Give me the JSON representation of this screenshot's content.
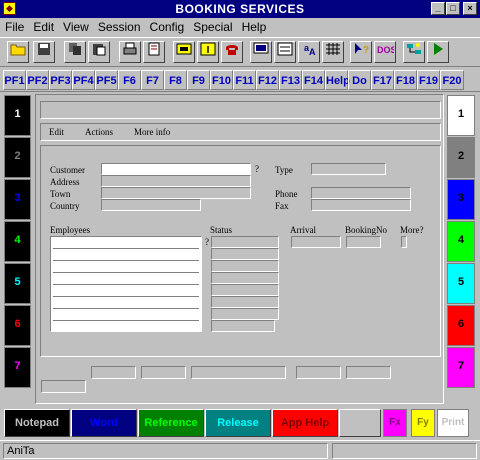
{
  "window": {
    "title": "BOOKING SERVICES",
    "icon": "app-icon"
  },
  "menu": [
    "File",
    "Edit",
    "View",
    "Session",
    "Config",
    "Special",
    "Help"
  ],
  "pf_keys": [
    "PF1",
    "PF2",
    "PF3",
    "PF4",
    "PF5",
    "F6",
    "F7",
    "F8",
    "F9",
    "F10",
    "F11",
    "F12",
    "F13",
    "F14",
    "Help",
    "Do",
    "F17",
    "F18",
    "F19",
    "F20"
  ],
  "left_sessions": [
    "1",
    "2",
    "3",
    "4",
    "5",
    "6",
    "7"
  ],
  "right_sessions": [
    "1",
    "2",
    "3",
    "4",
    "5",
    "6",
    "7"
  ],
  "form": {
    "menu": [
      "Edit",
      "Actions",
      "More info"
    ],
    "customer_label": "Customer",
    "address_label": "Address",
    "town_label": "Town",
    "country_label": "Country",
    "type_label": "Type",
    "phone_label": "Phone",
    "fax_label": "Fax",
    "question_mark": "?",
    "employees_label": "Employees",
    "status_label": "Status",
    "arrival_label": "Arrival",
    "bookingno_label": "BookingNo",
    "more_label": "More?",
    "employees_question": "?"
  },
  "apps": {
    "notepad": "Notepad",
    "word": "Word",
    "reference": "Reference",
    "release": "Release",
    "app_help": "App Help",
    "fx": "Fx",
    "fy": "Fy",
    "print": "Print"
  },
  "status_bar": {
    "text": "AniTa"
  },
  "colors": {
    "titlebar": "#000080",
    "pf_text": "#0000c0",
    "right_sessions": [
      "#ffffff",
      "#808080",
      "#0000ff",
      "#00ff00",
      "#00ffff",
      "#ff0000",
      "#ff00ff"
    ],
    "left_session_text": [
      "#ffffff",
      "#808080",
      "#0000ff",
      "#00ff00",
      "#00ffff",
      "#ff0000",
      "#ff00ff"
    ]
  }
}
